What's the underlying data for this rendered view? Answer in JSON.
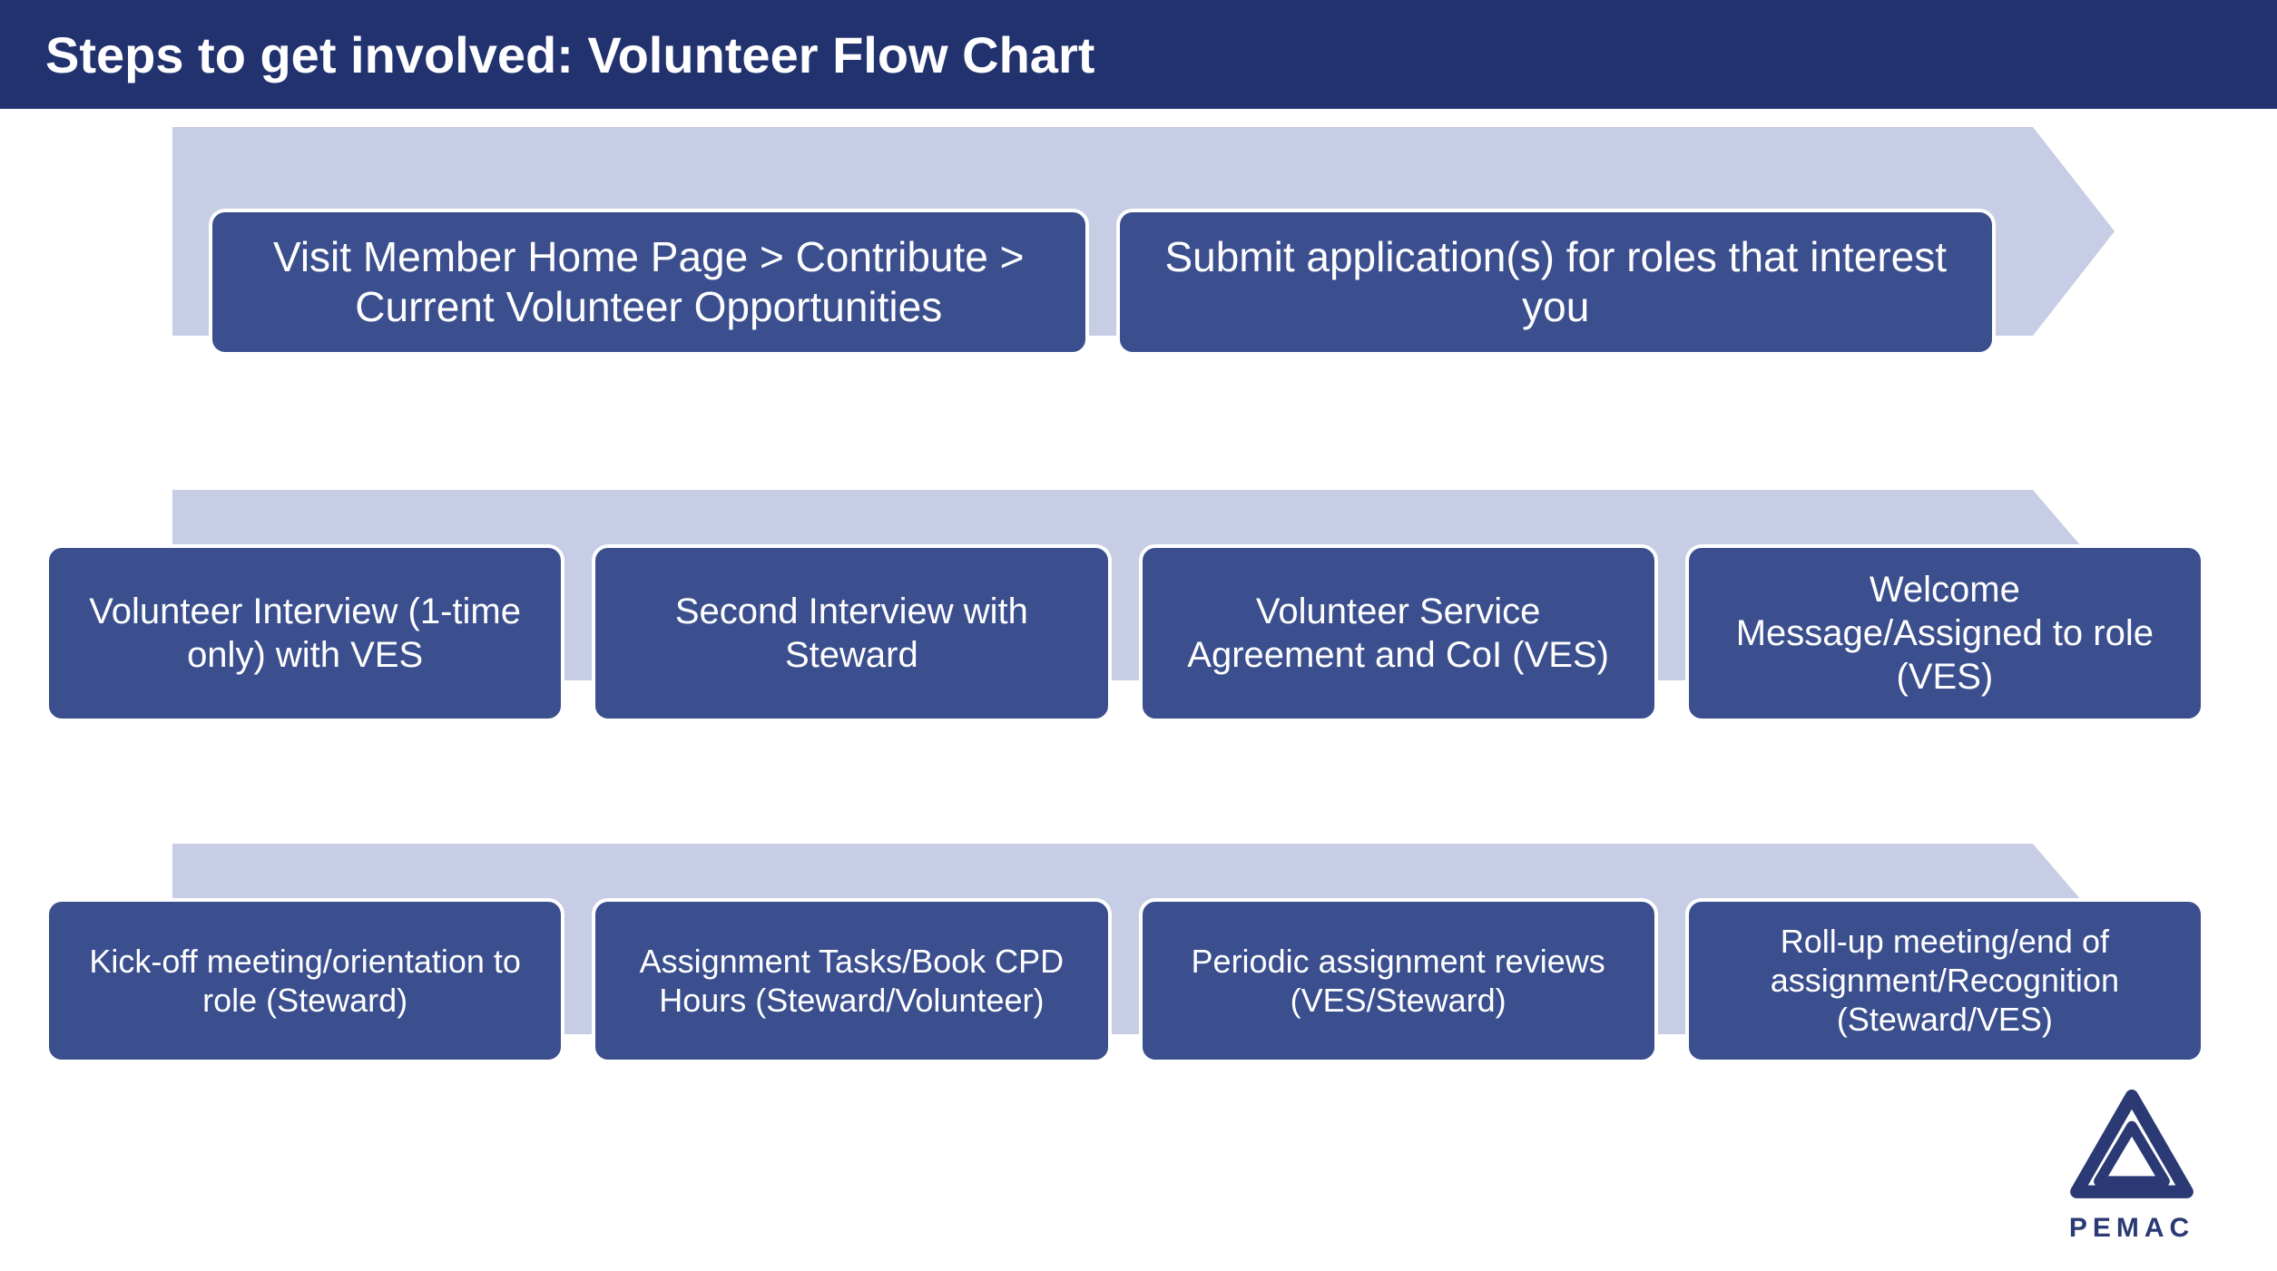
{
  "title": "Steps to get involved: Volunteer Flow Chart",
  "colors": {
    "header_bg": "#22326e",
    "arrow_bg": "#c7cde4",
    "box_bg": "#3b4f8f",
    "text_white": "#ffffff",
    "logo_color": "#2b3a75"
  },
  "rows": [
    {
      "steps": [
        "Visit Member Home Page > Contribute > Current Volunteer Opportunities",
        "Submit application(s) for roles that interest you"
      ]
    },
    {
      "steps": [
        "Volunteer Interview (1-time only) with VES",
        "Second Interview with Steward",
        "Volunteer Service Agreement and CoI (VES)",
        "Welcome Message/Assigned to role (VES)"
      ]
    },
    {
      "steps": [
        "Kick-off meeting/orientation to role (Steward)",
        "Assignment Tasks/Book CPD Hours (Steward/Volunteer)",
        "Periodic assignment reviews (VES/Steward)",
        "Roll-up meeting/end of assignment/Recognition (Steward/VES)"
      ]
    }
  ],
  "logo": {
    "label": "PEMAC"
  }
}
